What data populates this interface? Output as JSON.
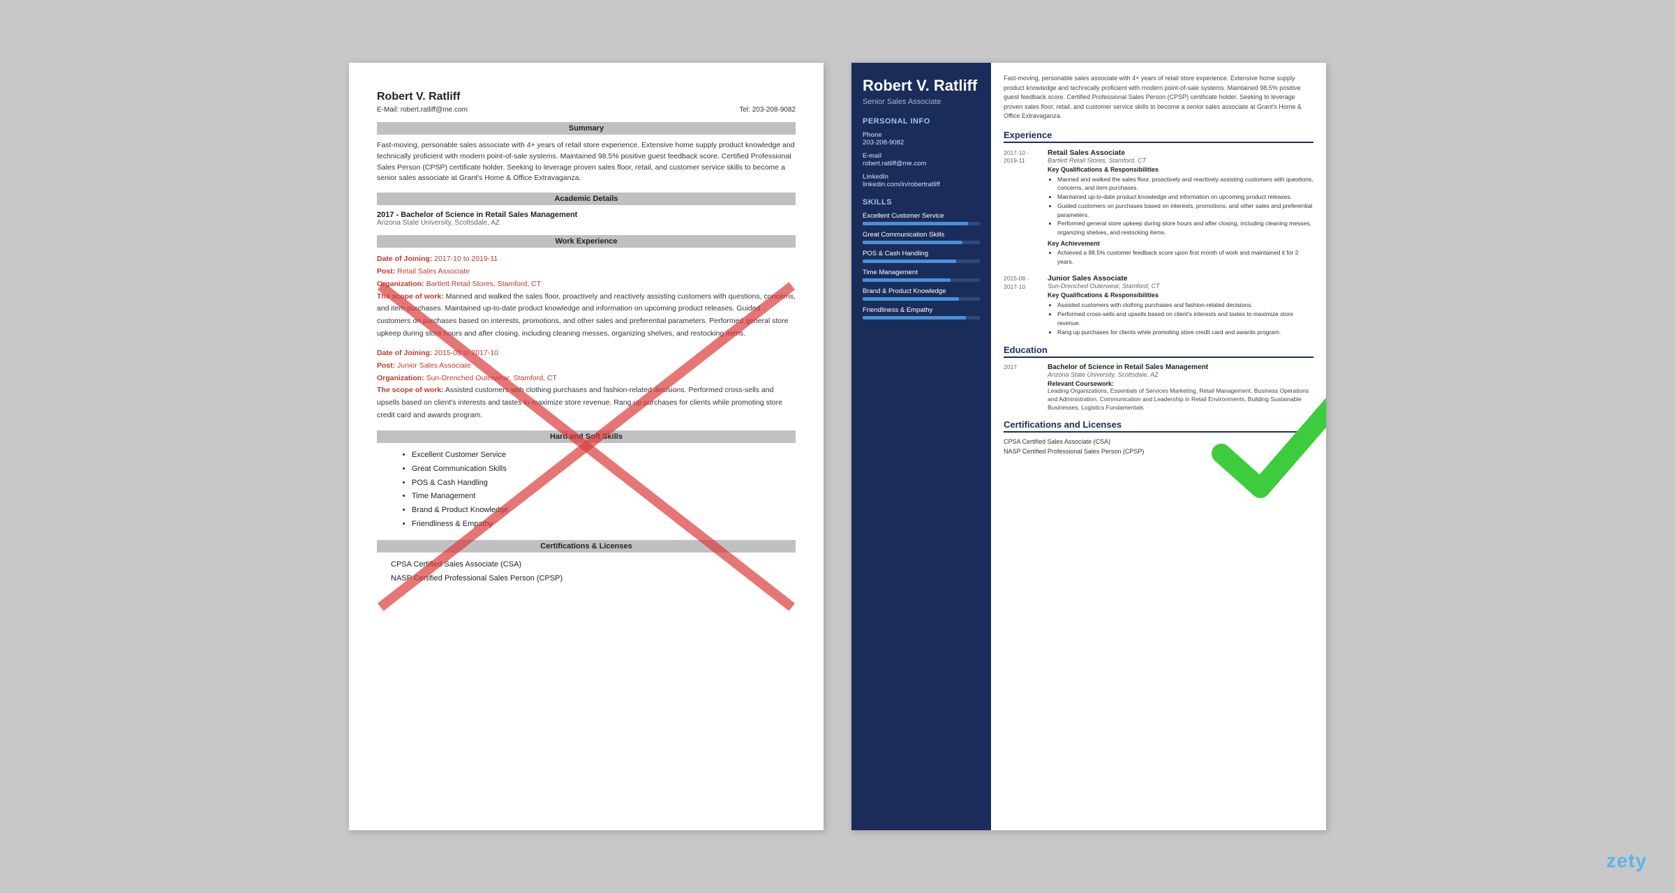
{
  "left_resume": {
    "name": "Robert V. Ratliff",
    "email_label": "E-Mail:",
    "email": "robert.ratliff@me.com",
    "tel_label": "Tel:",
    "tel": "203-208-9082",
    "sections": {
      "summary": {
        "title": "Summary",
        "text": "Fast-moving, personable sales associate with 4+ years of retail store experience. Extensive home supply product knowledge and technically proficient with modern point-of-sale systems. Maintained 98.5% positive guest feedback score. Certified Professional Sales Person (CPSP) certificate holder. Seeking to leverage proven sales floor, retail, and customer service skills to become a senior sales associate at Grant's Home & Office Extravaganza."
      },
      "academic": {
        "title": "Academic Details",
        "degree": "2017 - Bachelor of Science in Retail Sales Management",
        "school": "Arizona State University, Scottsdale, AZ"
      },
      "work": {
        "title": "Work Experience",
        "entries": [
          {
            "date_label": "Date of Joining:",
            "date": "2017-10 to 2019-11",
            "post_label": "Post:",
            "post": "Retail Sales Associate",
            "org_label": "Organization:",
            "org": "Bartlett Retail Stores, Stamford, CT",
            "scope_label": "The scope of work:",
            "scope": "Manned and walked the sales floor, proactively and reactively assisting customers with questions, concerns, and item purchases. Maintained up-to-date product knowledge and information on upcoming product releases. Guided customers on purchases based on interests, promotions, and other sales and preferential parameters. Performed general store upkeep during store hours and after closing, including cleaning messes, organizing shelves, and restocking items."
          },
          {
            "date_label": "Date of Joining:",
            "date": "2015-08 to 2017-10",
            "post_label": "Post:",
            "post": "Junior Sales Associate",
            "org_label": "Organization:",
            "org": "Sun-Drenched Outerwear, Stamford, CT",
            "scope_label": "The scope of work:",
            "scope": "Assisted customers with clothing purchases and fashion-related decisions. Performed cross-sells and upsells based on client's interests and tastes to maximize store revenue. Rang up purchases for clients while promoting store credit card and awards program."
          }
        ]
      },
      "skills": {
        "title": "Hard and Soft Skills",
        "items": [
          "Excellent Customer Service",
          "Great Communication Skills",
          "POS & Cash Handling",
          "Time Management",
          "Brand & Product Knowledge",
          "Friendliness & Empathy"
        ]
      },
      "certs": {
        "title": "Certifications & Licenses",
        "items": [
          "CPSA Certified Sales Associate (CSA)",
          "NASP Certified Professional Sales Person (CPSP)"
        ]
      }
    }
  },
  "right_resume": {
    "name": "Robert V. Ratliff",
    "title": "Senior Sales Associate",
    "intro": "Fast-moving, personable sales associate with 4+ years of retail store experience. Extensive home supply product knowledge and technically proficient with modern point-of-sale systems. Maintained 98.5% positive guest feedback score. Certified Professional Sales Person (CPSP) certificate holder. Seeking to leverage proven sales floor, retail, and customer service skills to become a senior sales associate at Grant's Home & Office Extravaganza.",
    "sidebar": {
      "personal_info_label": "Personal Info",
      "phone_label": "Phone",
      "phone": "203-208-9082",
      "email_label": "E-mail",
      "email": "robert.ratliff@me.com",
      "linkedin_label": "LinkedIn",
      "linkedin": "linkedin.com/in/robertratliff",
      "skills_label": "Skills",
      "skills": [
        {
          "name": "Excellent Customer Service",
          "pct": 90
        },
        {
          "name": "Great Communication Skills",
          "pct": 85
        },
        {
          "name": "POS & Cash Handling",
          "pct": 80
        },
        {
          "name": "Time Management",
          "pct": 75
        },
        {
          "name": "Brand & Product Knowledge",
          "pct": 82
        },
        {
          "name": "Friendliness & Empathy",
          "pct": 88
        }
      ]
    },
    "experience": {
      "title": "Experience",
      "entries": [
        {
          "date": "2017-10 -\n2019-11",
          "job_title": "Retail Sales Associate",
          "org": "Bartlett Retail Stores, Stamford, CT",
          "kq_label": "Key Qualifications & Responsibilities",
          "bullets": [
            "Manned and walked the sales floor, proactively and reactively assisting customers with questions, concerns, and item purchases.",
            "Maintained up-to-date product knowledge and information on upcoming product releases.",
            "Guided customers on purchases based on interests, promotions, and other sales and preferential parameters.",
            "Performed general store upkeep during store hours and after closing, including cleaning messes, organizing shelves, and restocking items."
          ],
          "achieve_label": "Key Achievement",
          "achievements": [
            "Achieved a 98.5% customer feedback score upon first month of work and maintained it for 2 years."
          ]
        },
        {
          "date": "2015-08 -\n2017-10",
          "job_title": "Junior Sales Associate",
          "org": "Sun-Drenched Outerwear, Stamford, CT",
          "kq_label": "Key Qualifications & Responsibilities",
          "bullets": [
            "Assisted customers with clothing purchases and fashion-related decisions.",
            "Performed cross-sells and upsells based on client's interests and tastes to maximize store revenue.",
            "Rang up purchases for clients while promoting store credit card and awards program."
          ]
        }
      ]
    },
    "education": {
      "title": "Education",
      "entries": [
        {
          "date": "2017",
          "degree": "Bachelor of Science in Retail Sales Management",
          "school": "Arizona State University, Scottsdale, AZ",
          "coursework_label": "Relevant Coursework:",
          "coursework": "Leading Organizations, Essentials of Services Marketing, Retail Management, Business Operations and Administration, Communication and Leadership in Retail Environments, Building Sustainable Businesses, Logistics Fundamentals"
        }
      ]
    },
    "certifications": {
      "title": "Certifications and Licenses",
      "items": [
        "CPSA Certified Sales Associate (CSA)",
        "NASP Certified Professional Sales Person (CPSP)"
      ]
    }
  },
  "watermark": "zety"
}
